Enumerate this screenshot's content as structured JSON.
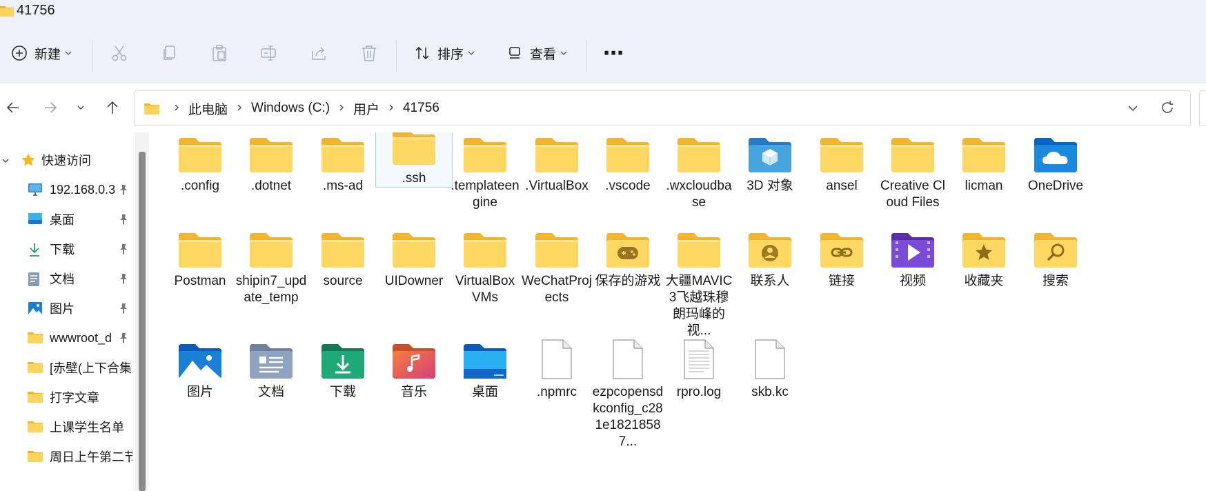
{
  "window": {
    "title": "41756"
  },
  "toolbar": {
    "new_label": "新建",
    "sort_label": "排序",
    "view_label": "查看",
    "more_label": "⋯"
  },
  "address": {
    "crumbs": [
      "此电脑",
      "Windows (C:)",
      "用户",
      "41756"
    ]
  },
  "sidebar": {
    "quick_access": "快速访问",
    "items": [
      {
        "label": "192.168.0.3",
        "icon": "monitor-icon",
        "pinned": true
      },
      {
        "label": "桌面",
        "icon": "desktop-icon",
        "pinned": true
      },
      {
        "label": "下载",
        "icon": "download-icon",
        "pinned": true
      },
      {
        "label": "文档",
        "icon": "document-icon",
        "pinned": true
      },
      {
        "label": "图片",
        "icon": "pictures-icon",
        "pinned": true
      },
      {
        "label": "wwwroot_d",
        "icon": "folder-icon",
        "pinned": true
      },
      {
        "label": "[赤壁(上下合集",
        "icon": "folder-icon",
        "pinned": false
      },
      {
        "label": "打字文章",
        "icon": "folder-icon",
        "pinned": false
      },
      {
        "label": "上课学生名单",
        "icon": "folder-icon",
        "pinned": false
      },
      {
        "label": "周日上午第二节",
        "icon": "folder-icon",
        "pinned": false
      }
    ]
  },
  "files": [
    {
      "name": ".config",
      "type": "folder"
    },
    {
      "name": ".dotnet",
      "type": "folder"
    },
    {
      "name": ".ms-ad",
      "type": "folder"
    },
    {
      "name": ".ssh",
      "type": "folder",
      "selected": true
    },
    {
      "name": ".templateengine",
      "type": "folder"
    },
    {
      "name": ".VirtualBox",
      "type": "folder"
    },
    {
      "name": ".vscode",
      "type": "folder"
    },
    {
      "name": ".wxcloudbase",
      "type": "folder"
    },
    {
      "name": "3D 对象",
      "type": "3d"
    },
    {
      "name": "ansel",
      "type": "folder"
    },
    {
      "name": "Creative Cloud Files",
      "type": "folder"
    },
    {
      "name": "licman",
      "type": "folder"
    },
    {
      "name": "OneDrive",
      "type": "onedrive"
    },
    {
      "name": "Postman",
      "type": "folder"
    },
    {
      "name": "shipin7_update_temp",
      "type": "folder"
    },
    {
      "name": "source",
      "type": "folder"
    },
    {
      "name": "UIDowner",
      "type": "folder"
    },
    {
      "name": "VirtualBox VMs",
      "type": "folder"
    },
    {
      "name": "WeChatProjects",
      "type": "folder"
    },
    {
      "name": "保存的游戏",
      "type": "games"
    },
    {
      "name": "大疆MAVIC 3飞越珠穆朗玛峰的视...",
      "type": "folder"
    },
    {
      "name": "联系人",
      "type": "contacts"
    },
    {
      "name": "链接",
      "type": "links"
    },
    {
      "name": "视频",
      "type": "videos"
    },
    {
      "name": "收藏夹",
      "type": "favorites"
    },
    {
      "name": "搜索",
      "type": "search"
    },
    {
      "name": "图片",
      "type": "pictures"
    },
    {
      "name": "文档",
      "type": "documents"
    },
    {
      "name": "下载",
      "type": "downloads"
    },
    {
      "name": "音乐",
      "type": "music"
    },
    {
      "name": "桌面",
      "type": "desktop"
    },
    {
      "name": ".npmrc",
      "type": "file"
    },
    {
      "name": "ezpcopensdkconfig_c281e18218587...",
      "type": "file"
    },
    {
      "name": "rpro.log",
      "type": "textfile"
    },
    {
      "name": "skb.kc",
      "type": "file"
    }
  ],
  "colors": {
    "chrome_bg": "#eef2f8",
    "folder_yellow": "#ffd45c",
    "selection_border": "#99d1ff"
  }
}
